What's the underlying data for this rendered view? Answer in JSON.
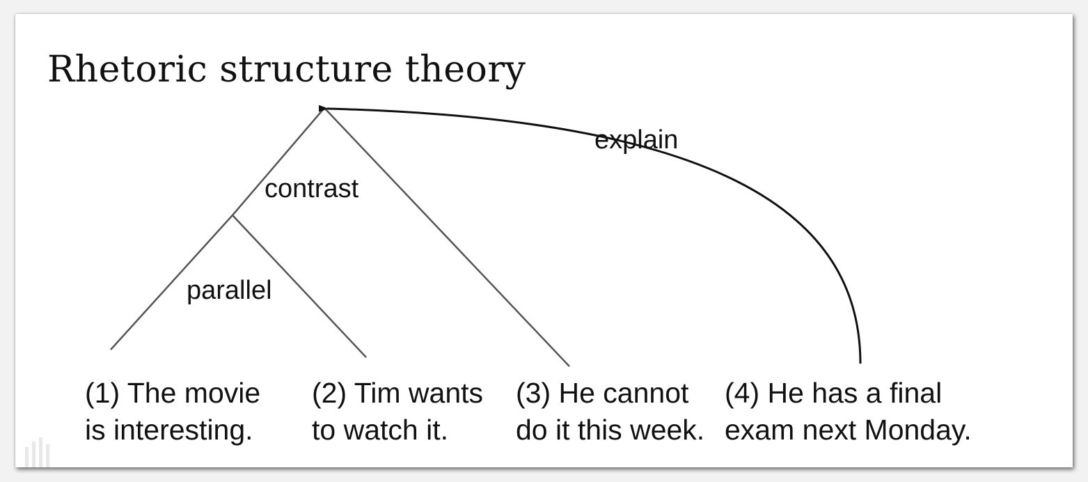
{
  "slide": {
    "title": "Rhetoric structure theory"
  },
  "relations": {
    "contrast": "contrast",
    "parallel": "parallel",
    "explain": "explain"
  },
  "leaves": [
    {
      "line1": "(1) The movie",
      "line2": "is interesting."
    },
    {
      "line1": "(2) Tim wants",
      "line2": "to watch it."
    },
    {
      "line1": "(3) He cannot",
      "line2": "do it this week."
    },
    {
      "line1": "(4) He has a final",
      "line2": "exam next Monday."
    }
  ]
}
